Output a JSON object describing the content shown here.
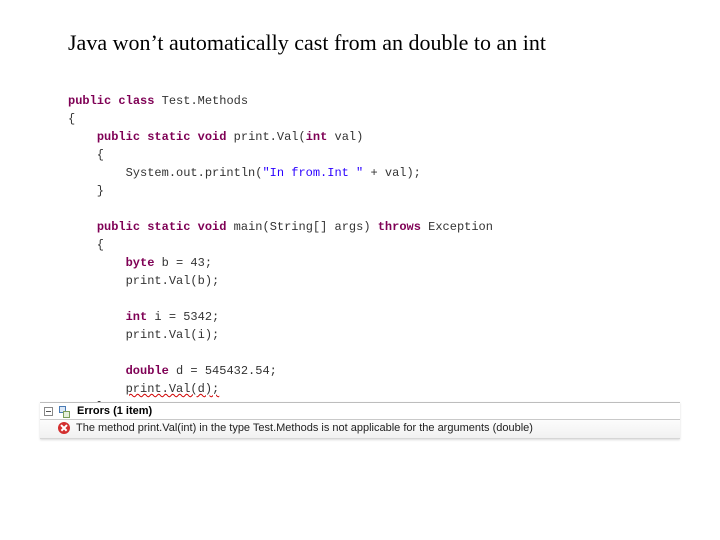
{
  "title": "Java won’t automatically cast from an double to an int",
  "code": {
    "kw_public": "public",
    "kw_class": "class",
    "cls_name": "Test.Methods",
    "kw_static": "static",
    "kw_void": "void",
    "m_printVal": "print.Val",
    "kw_int": "int",
    "p_val": "val",
    "stmt_print": "System.out.println",
    "str_infromint": "\"In from.Int \"",
    "op_plus": " + ",
    "var_val": "val",
    "m_main": "main",
    "p_args": "String[] args",
    "kw_throws": "throws",
    "cls_exception": "Exception",
    "kw_byte": "byte",
    "stmt_b": " b = 43;",
    "call_b": "print.Val(b);",
    "stmt_i": " i = 5342;",
    "call_i": "print.Val(i);",
    "kw_double": "double",
    "stmt_d": " d = 545432.54;",
    "call_d": "print.Val(d);"
  },
  "errors": {
    "header": "Errors (1 item)",
    "items": [
      "The method print.Val(int) in the type Test.Methods is not applicable for the arguments (double)"
    ]
  }
}
